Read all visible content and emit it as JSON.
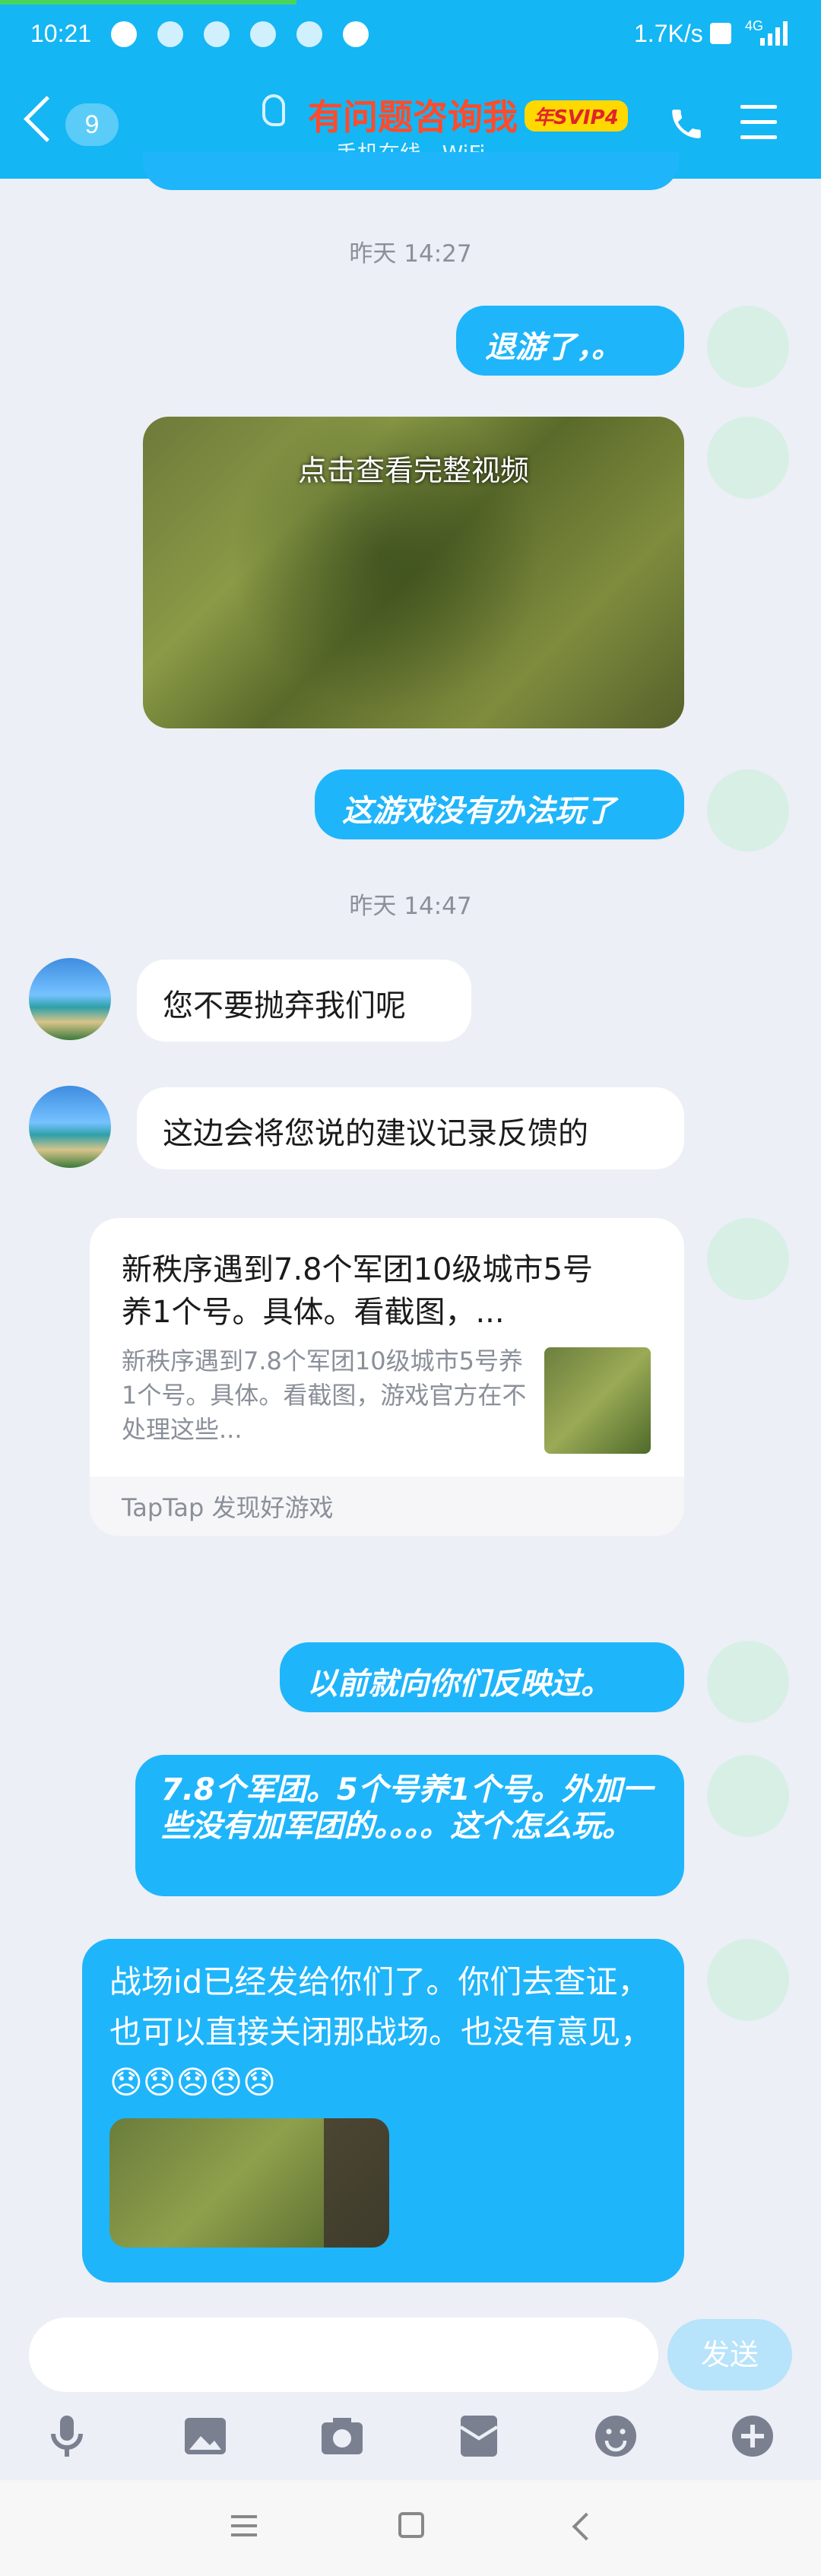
{
  "status": {
    "time": "10:21",
    "speed": "1.7K/s",
    "net": "4G"
  },
  "header": {
    "badge_count": "9",
    "title": "有问题咨询我",
    "vip": "年SVIP4",
    "subtitle": "手机在线 - WiFi"
  },
  "messages": {
    "ts1": "昨天 14:27",
    "r1": "退游了，。",
    "video_overlay": "点击查看完整视频",
    "r2": "这游戏没有办法玩了",
    "ts2": "昨天 14:47",
    "l1": "您不要抛弃我们呢",
    "l2": "这边会将您说的建议记录反馈的",
    "card_title": "新秩序遇到7.8个军团10级城市5号养1个号。具体。看截图，...",
    "card_desc": "新秩序遇到7.8个军团10级城市5号养1个号。具体。看截图，游戏官方在不处理这些...",
    "card_source": "TapTap 发现好游戏",
    "r3": "以前就向你们反映过。",
    "r4": "7.8个军团。5个号养1个号。外加一些没有加军团的。。。。这个怎么玩。",
    "r5": "战场id已经发给你们了。你们去查证，也可以直接关闭那战场。也没有意见，😞😞😞😞😞"
  },
  "input": {
    "send": "发送"
  },
  "colors": {
    "header": "#14b6f4",
    "bubble_self": "#1fb5fb",
    "title": "#ff4b2b"
  }
}
